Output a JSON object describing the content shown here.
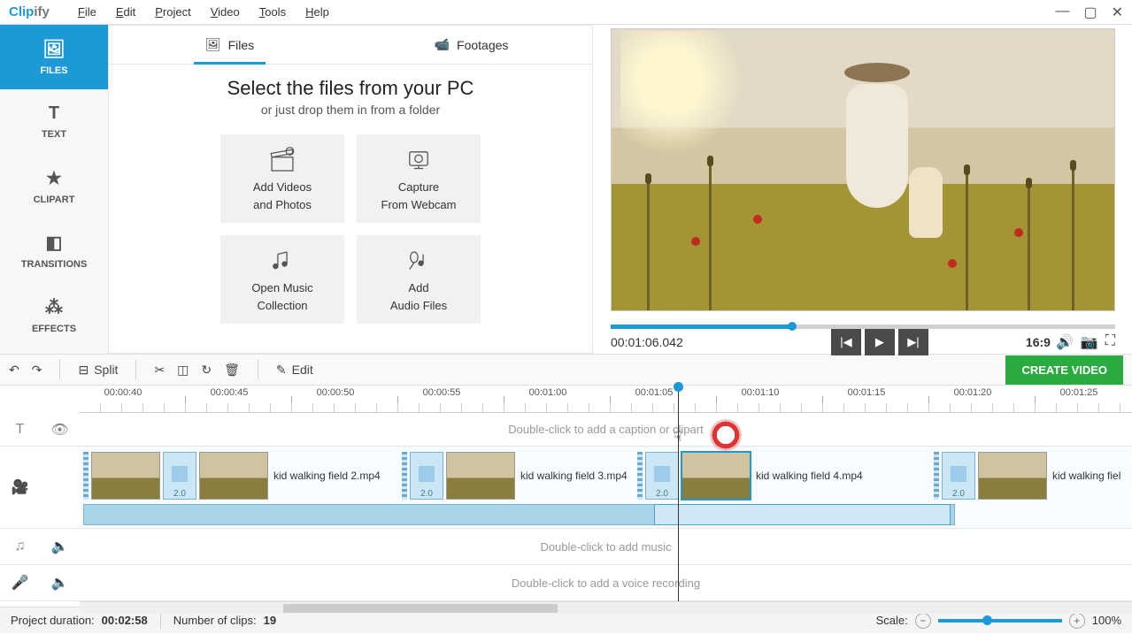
{
  "app": {
    "name1": "Clip",
    "name2": "ify"
  },
  "menu": {
    "file": "File",
    "edit": "Edit",
    "project": "Project",
    "video": "Video",
    "tools": "Tools",
    "help": "Help"
  },
  "leftTabs": {
    "files": "FILES",
    "text": "TEXT",
    "clipart": "CLIPART",
    "transitions": "TRANSITIONS",
    "effects": "EFFECTS"
  },
  "filesPanel": {
    "tabFiles": "Files",
    "tabFootages": "Footages",
    "heading": "Select the files from your PC",
    "sub": "or just drop them in from a folder",
    "cardVideos1": "Add Videos",
    "cardVideos2": "and Photos",
    "cardWebcam1": "Capture",
    "cardWebcam2": "From Webcam",
    "cardMusic1": "Open Music",
    "cardMusic2": "Collection",
    "cardAudio1": "Add",
    "cardAudio2": "Audio Files"
  },
  "preview": {
    "timecode": "00:01:06.042",
    "aspect": "16:9"
  },
  "toolbar": {
    "split": "Split",
    "edit": "Edit",
    "create": "CREATE VIDEO"
  },
  "timeline": {
    "ruler": [
      "00:00:40",
      "00:00:45",
      "00:00:50",
      "00:00:55",
      "00:01:00",
      "00:01:05",
      "00:01:10",
      "00:01:15",
      "00:01:20",
      "00:01:25"
    ],
    "captionHint": "Double-click to add a caption or clipart",
    "musicHint": "Double-click to add music",
    "voiceHint": "Double-click to add a voice recording",
    "clips": {
      "c1": "kid walking field 2.mp4",
      "c2": "kid walking field 3.mp4",
      "c3": "kid walking field 4.mp4",
      "c4": "kid walking fiel"
    },
    "transDur": "2.0"
  },
  "status": {
    "durLabel": "Project duration:",
    "duration": "00:02:58",
    "clipsLabel": "Number of clips:",
    "clips": "19",
    "scaleLabel": "Scale:",
    "zoom": "100%"
  }
}
